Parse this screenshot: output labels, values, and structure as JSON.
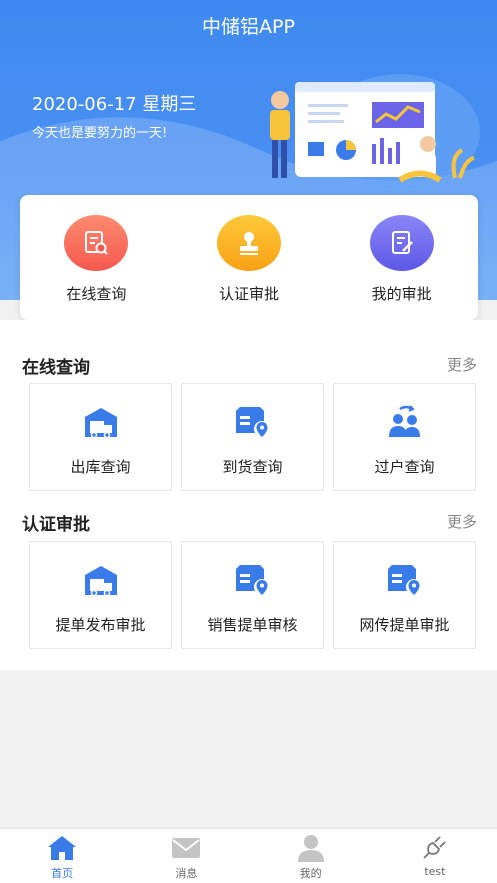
{
  "header": {
    "app_title": "中储铝APP",
    "date": "2020-06-17 星期三",
    "slogan": "今天也是要努力的一天!"
  },
  "quick_actions": [
    {
      "label": "在线查询",
      "icon": "search-document-icon",
      "color": "#f4594f"
    },
    {
      "label": "认证审批",
      "icon": "stamp-icon",
      "color": "#f7a114"
    },
    {
      "label": "我的审批",
      "icon": "edit-document-icon",
      "color": "#5d58e6"
    }
  ],
  "sections": [
    {
      "title": "在线查询",
      "more": "更多",
      "tiles": [
        {
          "label": "出库查询",
          "icon": "warehouse-truck-icon"
        },
        {
          "label": "到货查询",
          "icon": "package-location-icon"
        },
        {
          "label": "过户查询",
          "icon": "transfer-users-icon"
        }
      ]
    },
    {
      "title": "认证审批",
      "more": "更多",
      "tiles": [
        {
          "label": "提单发布审批",
          "icon": "warehouse-truck-icon"
        },
        {
          "label": "销售提单审核",
          "icon": "package-location-icon"
        },
        {
          "label": "网传提单审批",
          "icon": "package-location-icon"
        }
      ]
    }
  ],
  "tabbar": [
    {
      "label": "首页",
      "icon": "home-icon",
      "active": true
    },
    {
      "label": "消息",
      "icon": "mail-icon",
      "active": false
    },
    {
      "label": "我的",
      "icon": "user-icon",
      "active": false
    },
    {
      "label": "test",
      "icon": "plug-icon",
      "active": false
    }
  ],
  "colors": {
    "primary": "#3e8af0",
    "tile_icon": "#3a7bea",
    "tab_active": "#3a7bea",
    "tab_inactive": "#c4c4c4"
  }
}
